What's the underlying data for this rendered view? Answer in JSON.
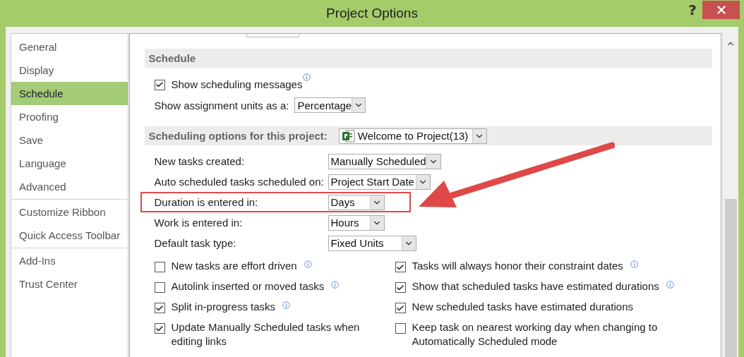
{
  "window": {
    "title": "Project Options",
    "help": "?"
  },
  "sidebar": {
    "groups": [
      [
        {
          "label": "General",
          "selected": false
        },
        {
          "label": "Display",
          "selected": false
        },
        {
          "label": "Schedule",
          "selected": true
        },
        {
          "label": "Proofing",
          "selected": false
        },
        {
          "label": "Save",
          "selected": false
        },
        {
          "label": "Language",
          "selected": false
        },
        {
          "label": "Advanced",
          "selected": false
        }
      ],
      [
        {
          "label": "Customize Ribbon",
          "selected": false
        },
        {
          "label": "Quick Access Toolbar",
          "selected": false
        }
      ],
      [
        {
          "label": "Add-Ins",
          "selected": false
        },
        {
          "label": "Trust Center",
          "selected": false
        }
      ]
    ]
  },
  "schedule_section": {
    "title": "Schedule",
    "show_messages": {
      "label": "Show scheduling messages",
      "checked": true,
      "info": true
    },
    "assignment_units": {
      "label": "Show assignment units as a:",
      "value": "Percentage"
    }
  },
  "project_section": {
    "title": "Scheduling options for this project:",
    "project": "Welcome to Project(13)",
    "settings": [
      {
        "label": "New tasks created:",
        "value": "Manually Scheduled",
        "highlighted": false
      },
      {
        "label": "Auto scheduled tasks scheduled on:",
        "value": "Project Start Date",
        "highlighted": false
      },
      {
        "label": "Duration is entered in:",
        "value": "Days",
        "highlighted": true
      },
      {
        "label": "Work is entered in:",
        "value": "Hours",
        "highlighted": false
      },
      {
        "label": "Default task type:",
        "value": "Fixed Units",
        "highlighted": false
      }
    ],
    "options": [
      {
        "label": "New tasks are effort driven",
        "checked": false,
        "info": true
      },
      {
        "label": "Tasks will always honor their constraint dates",
        "checked": true,
        "info": true
      },
      {
        "label": "Autolink inserted or moved tasks",
        "checked": false,
        "info": true
      },
      {
        "label": "Show that scheduled tasks have estimated durations",
        "checked": true,
        "info": true
      },
      {
        "label": "Split in-progress tasks",
        "checked": true,
        "info": true
      },
      {
        "label": "New scheduled tasks have estimated durations",
        "checked": true,
        "info": false
      },
      {
        "label": "Update Manually Scheduled tasks when editing links",
        "checked": true,
        "info": false
      },
      {
        "label": "Keep task on nearest working day when changing to Automatically Scheduled mode",
        "checked": false,
        "info": false
      }
    ]
  }
}
